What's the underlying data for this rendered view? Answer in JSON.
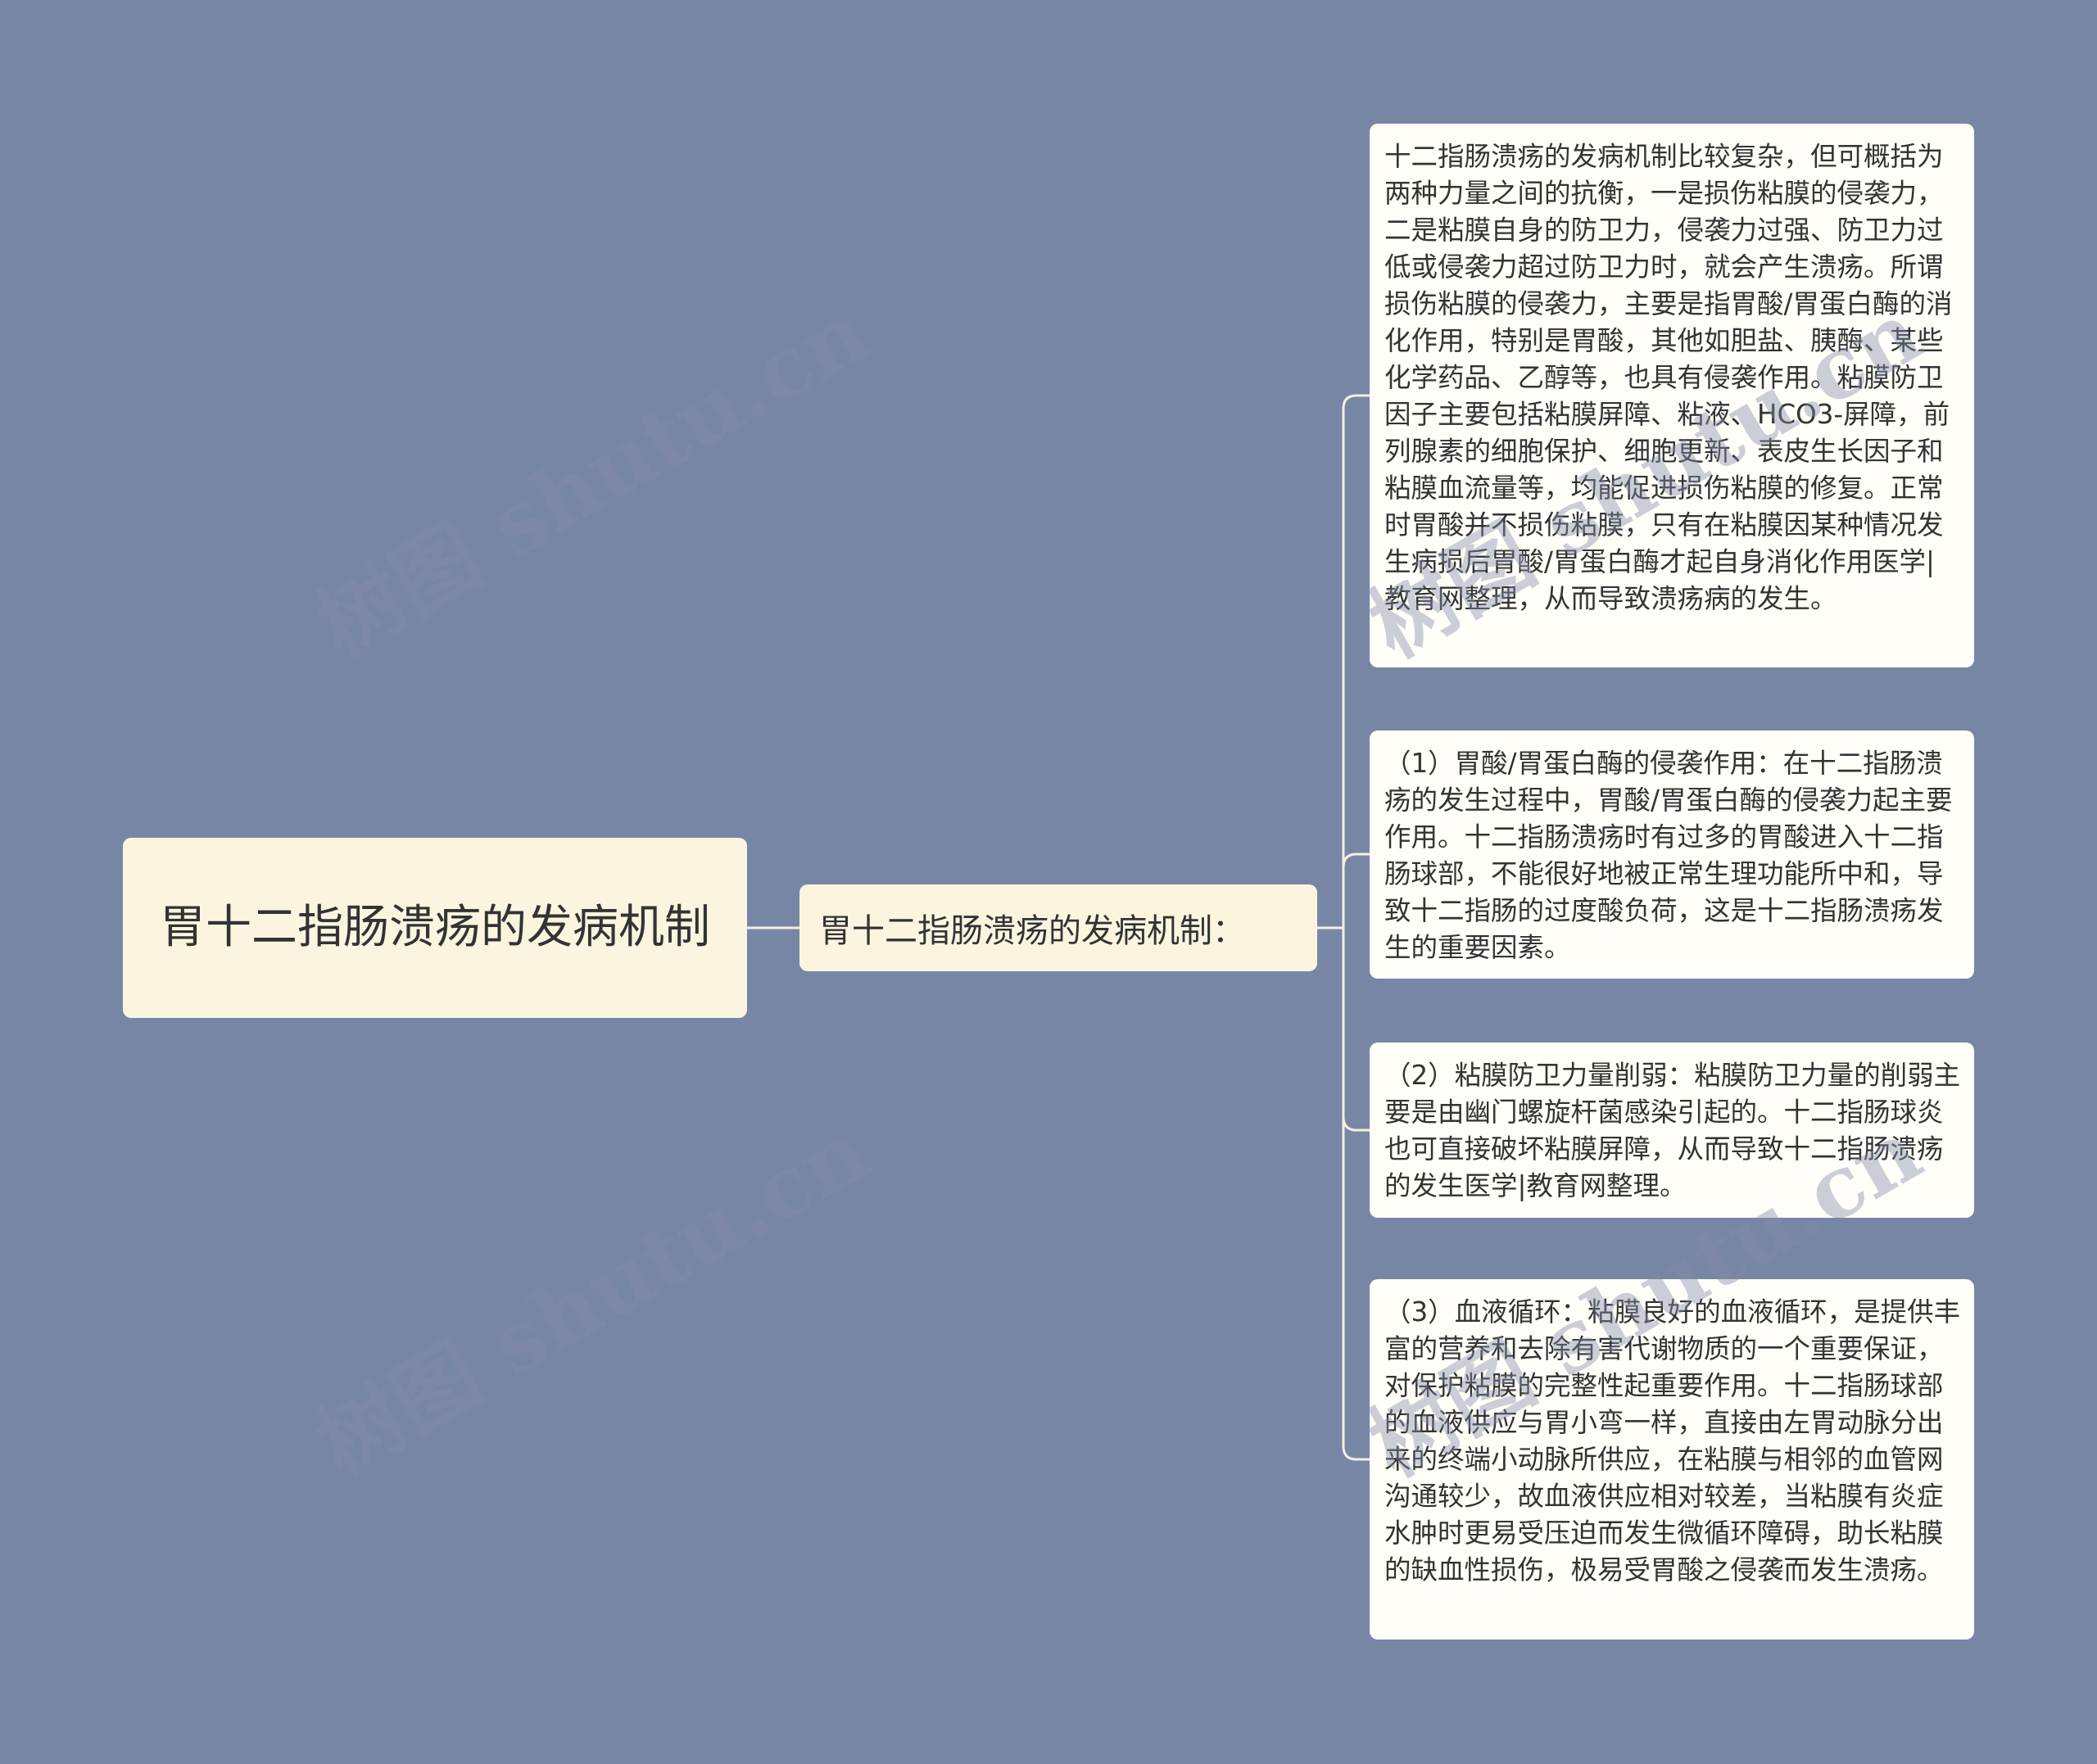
{
  "root": {
    "label": "胃十二指肠溃疡的发病机制"
  },
  "branch": {
    "label": "胃十二指肠溃疡的发病机制："
  },
  "leaves": [
    "十二指肠溃疡的发病机制比较复杂，但可概括为两种力量之间的抗衡，一是损伤粘膜的侵袭力，二是粘膜自身的防卫力，侵袭力过强、防卫力过低或侵袭力超过防卫力时，就会产生溃疡。所谓损伤粘膜的侵袭力，主要是指胃酸/胃蛋白酶的消化作用，特别是胃酸，其他如胆盐、胰酶、某些化学药品、乙醇等，也具有侵袭作用。粘膜防卫因子主要包括粘膜屏障、粘液、HCO3-屏障，前列腺素的细胞保护、细胞更新、表皮生长因子和粘膜血流量等，均能促进损伤粘膜的修复。正常时胃酸并不损伤粘膜，只有在粘膜因某种情况发生病损后胃酸/胃蛋白酶才起自身消化作用医学|教育网整理，从而导致溃疡病的发生。",
    "（1）胃酸/胃蛋白酶的侵袭作用：在十二指肠溃疡的发生过程中，胃酸/胃蛋白酶的侵袭力起主要作用。十二指肠溃疡时有过多的胃酸进入十二指肠球部，不能很好地被正常生理功能所中和，导致十二指肠的过度酸负荷，这是十二指肠溃疡发生的重要因素。",
    "（2）粘膜防卫力量削弱：粘膜防卫力量的削弱主要是由幽门螺旋杆菌感染引起的。十二指肠球炎也可直接破坏粘膜屏障，从而导致十二指肠溃疡的发生医学|教育网整理。",
    "（3）血液循环：粘膜良好的血液循环，是提供丰富的营养和去除有害代谢物质的一个重要保证，对保护粘膜的完整性起重要作用。十二指肠球部的血液供应与胃小弯一样，直接由左胃动脉分出来的终端小动脉所供应，在粘膜与相邻的血管网沟通较少，故血液供应相对较差，当粘膜有炎症水肿时更易受压迫而发生微循环障碍，助长粘膜的缺血性损伤，极易受胃酸之侵袭而发生溃疡。"
  ],
  "watermark": "树图 shutu.cn",
  "colors": {
    "background": "#7886a6",
    "node_fill": "#fbf5e0",
    "leaf_fill": "#fffef8",
    "line": "#f2f0e4"
  }
}
